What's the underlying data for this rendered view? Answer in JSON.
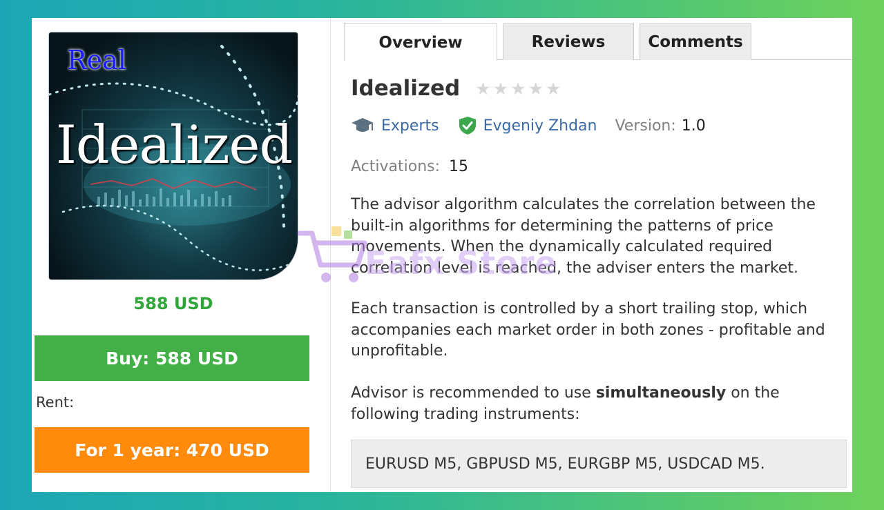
{
  "product": {
    "image_tag": "Real",
    "image_title": "Idealized",
    "price": "588 USD",
    "buy_label": "Buy: 588 USD",
    "rent_label": "Rent:",
    "rent_button_label": "For 1 year: 470 USD"
  },
  "tabs": [
    {
      "label": "Overview",
      "active": true
    },
    {
      "label": "Reviews",
      "active": false
    },
    {
      "label": "Comments",
      "active": false
    }
  ],
  "overview": {
    "title": "Idealized",
    "rating": 0,
    "category": "Experts",
    "author": "Evgeniy Zhdan",
    "version_label": "Version:",
    "version": "1.0",
    "activations_label": "Activations:",
    "activations": "15",
    "paragraph1": "The advisor algorithm calculates the correlation between the built-in algorithms for determining the patterns of price movements. When the dynamically calculated required correlation level is reached, the adviser enters the market.",
    "paragraph2": "Each transaction is controlled by a short trailing stop, which accompanies each market order in both zones - profitable and unprofitable.",
    "paragraph3_before": "Advisor is recommended to use ",
    "paragraph3_bold": "simultaneously",
    "paragraph3_after": " on the following trading instruments:",
    "instruments": "EURUSD M5, GBPUSD M5, EURGBP M5, USDCAD M5."
  },
  "watermark": "Eafx Store",
  "colors": {
    "buy": "#43b047",
    "rent": "#ff8a0c",
    "price": "#2fa53a",
    "link": "#3a6aa8"
  },
  "icons": [
    "graduation-cap-icon",
    "verified-shield-icon",
    "star-icon",
    "cart-icon"
  ]
}
